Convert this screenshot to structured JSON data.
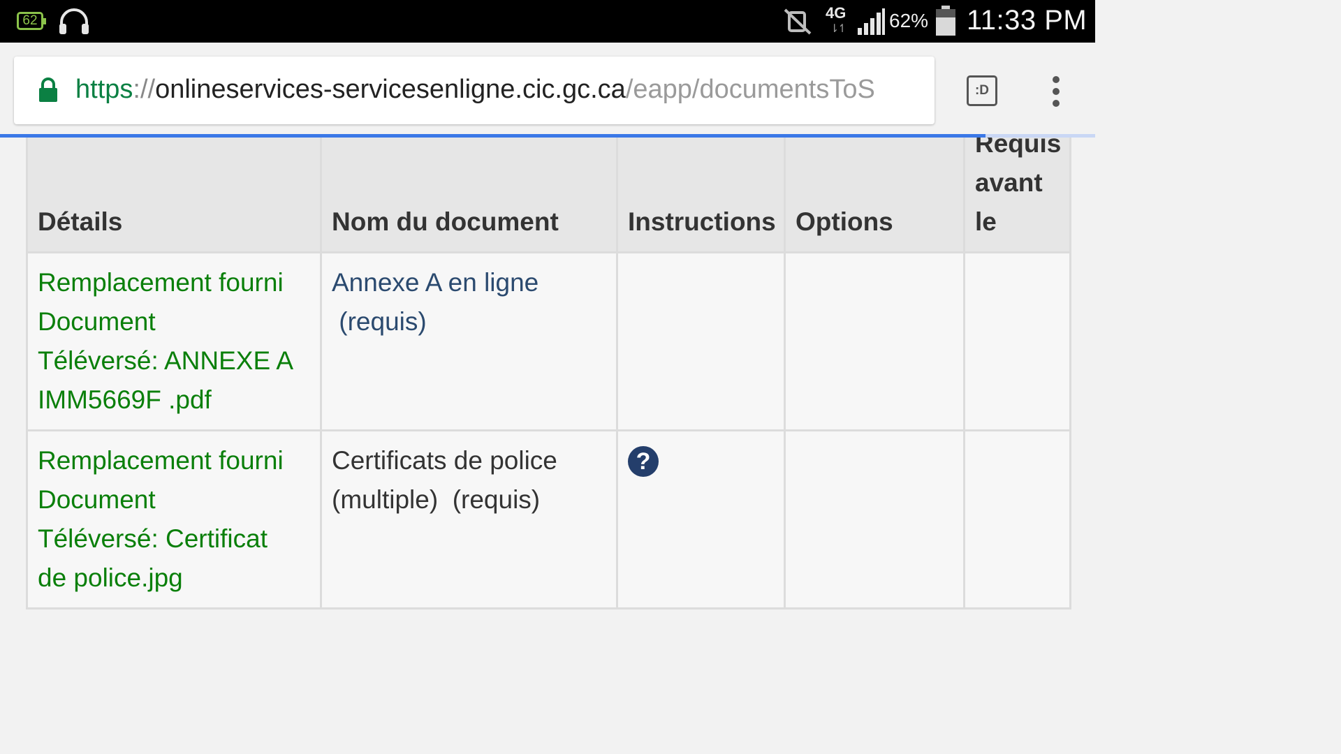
{
  "status_bar": {
    "notification_badge": "62",
    "network": "4G",
    "battery_percent": "62%",
    "time": "11:33 PM"
  },
  "browser": {
    "url_scheme": "https",
    "url_separator": "://",
    "url_host": "onlineservices-servicesenligne.cic.gc.ca",
    "url_path": "/eapp/documentsToS",
    "tabs_label": ":D",
    "progress": 0.9
  },
  "table": {
    "headers": [
      "Détails",
      "Nom du document",
      "Instructions",
      "Options"
    ],
    "header_req_lines": [
      "Requis",
      "avant",
      "le"
    ],
    "rows": [
      {
        "details": [
          "Remplacement fourni",
          "Document",
          "Téléversé: ANNEXE A",
          "IMM5669F .pdf"
        ],
        "document_lines": [
          "Annexe A en ligne",
          " (requis)"
        ],
        "has_help": false
      },
      {
        "details": [
          "Remplacement fourni",
          "Document",
          "Téléversé: Certificat",
          "de police.jpg"
        ],
        "document_lines": [
          "Certificats de police",
          "(multiple)  (requis)"
        ],
        "has_help": true,
        "help_symbol": "?"
      }
    ]
  },
  "colors": {
    "link_green": "#0a7f0a",
    "link_blue": "#2b4a6f",
    "help_icon": "#243e6b",
    "progress_bar": "#3b78e7"
  }
}
